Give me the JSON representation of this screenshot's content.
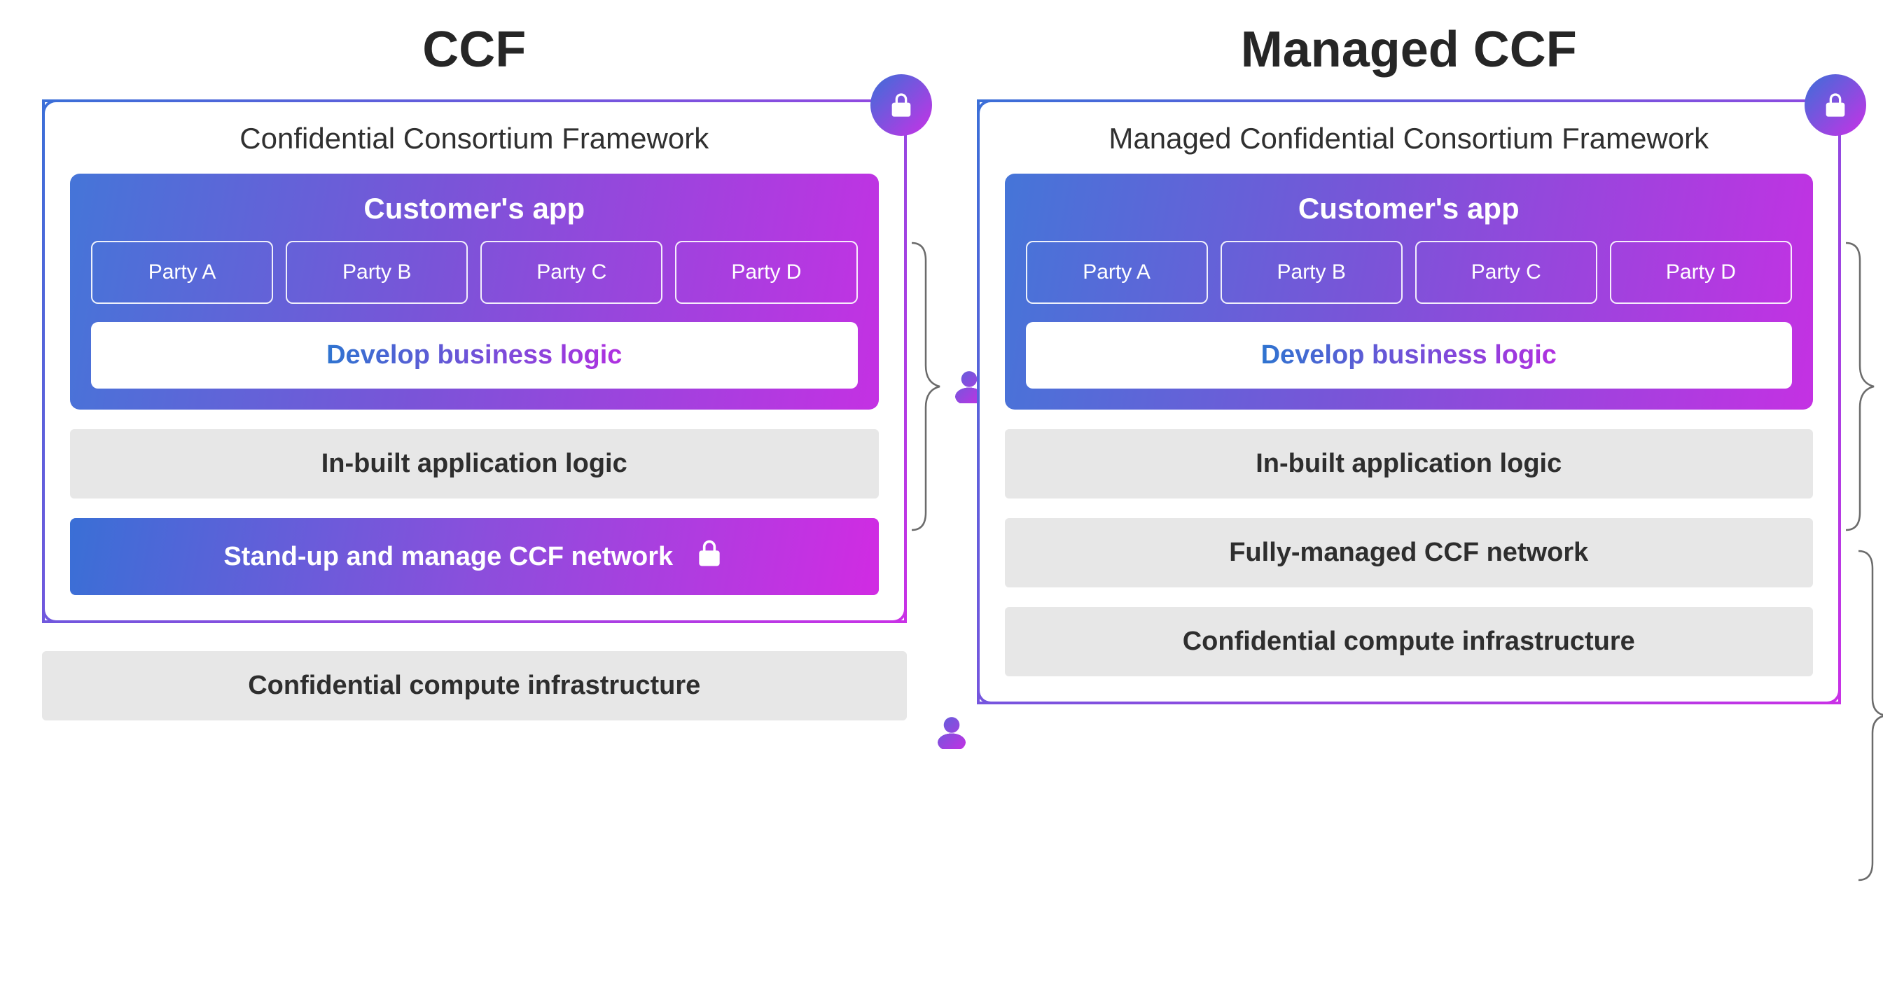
{
  "left": {
    "title": "CCF",
    "subtitle": "Confidential Consortium Framework",
    "app_title": "Customer's app",
    "parties": [
      "Party A",
      "Party B",
      "Party C",
      "Party D"
    ],
    "develop_label": "Develop business logic",
    "inbuilt_label": "In-built application logic",
    "manage_label": "Stand-up and manage CCF network",
    "infra_label": "Confidential compute infrastructure"
  },
  "right": {
    "title": "Managed CCF",
    "subtitle": "Managed Confidential Consortium Framework",
    "app_title": "Customer's app",
    "parties": [
      "Party A",
      "Party B",
      "Party C",
      "Party D"
    ],
    "develop_label": "Develop business logic",
    "inbuilt_label": "In-built application logic",
    "managed_label": "Fully-managed CCF network",
    "infra_label": "Confidential compute infrastructure"
  }
}
